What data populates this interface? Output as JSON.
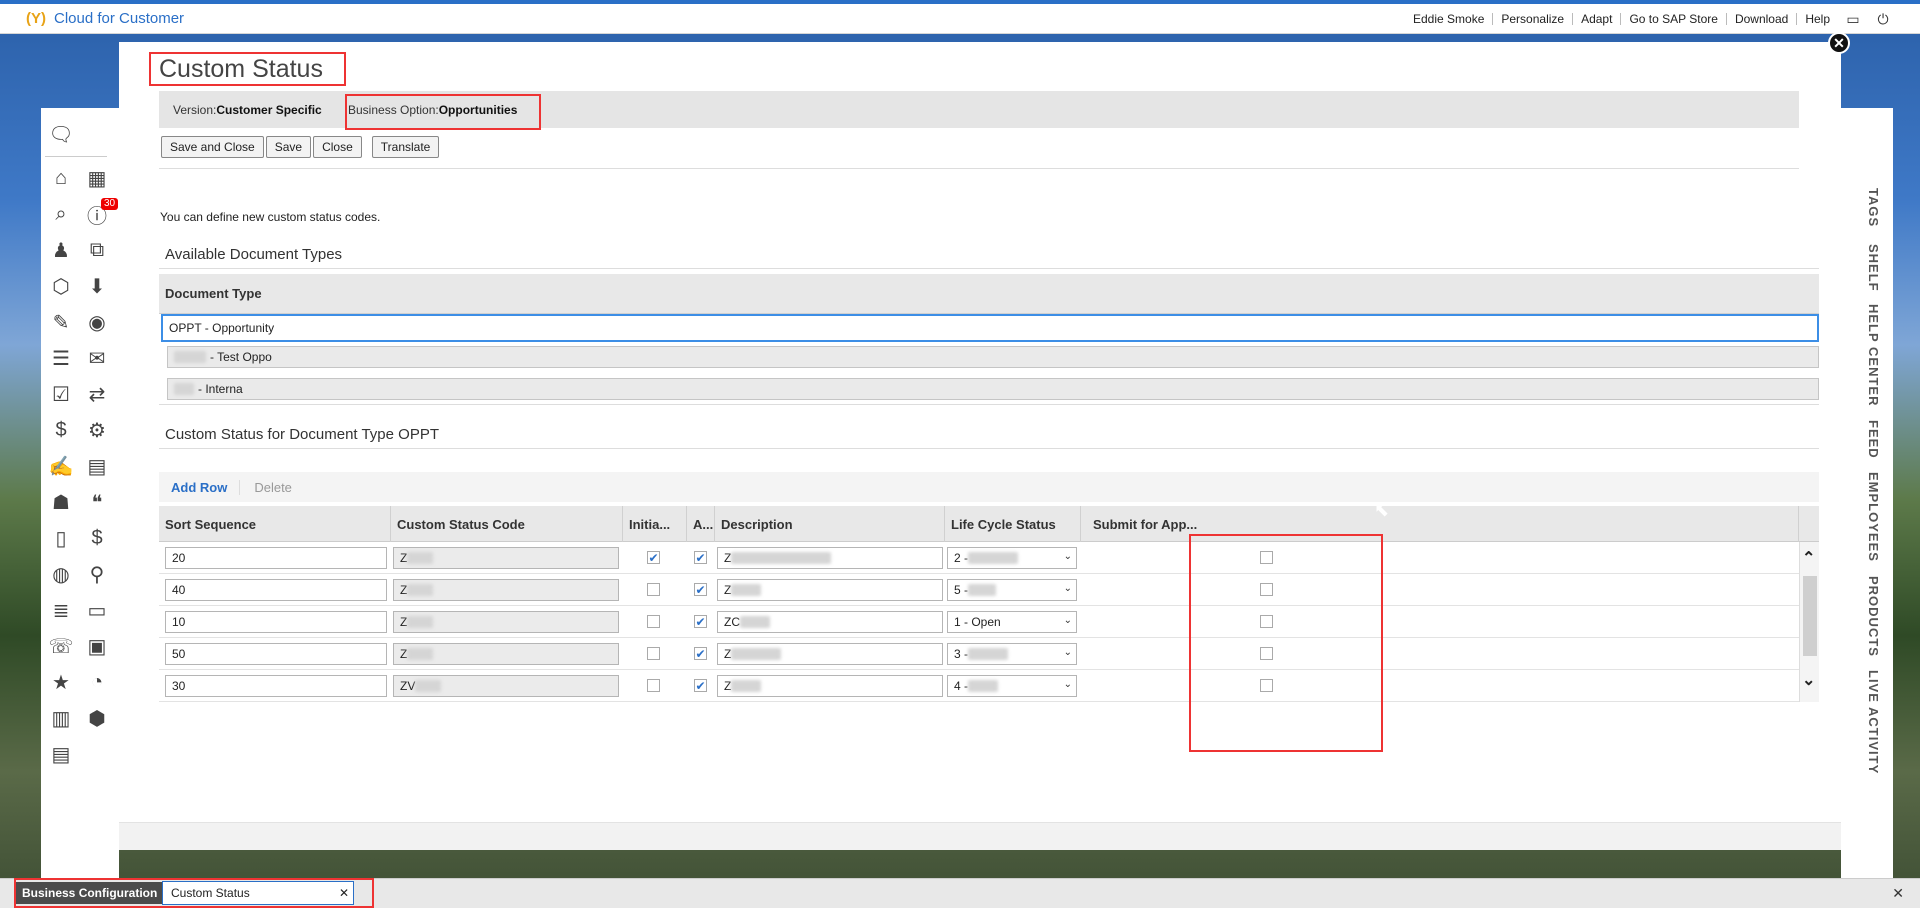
{
  "app": {
    "title": "Cloud for Customer",
    "logo_mark": "(Y)"
  },
  "topnav": {
    "items": [
      "Eddie Smoke",
      "Personalize",
      "Adapt",
      "Go to SAP Store",
      "Download",
      "Help"
    ],
    "icons": [
      "window-icon",
      "power-icon"
    ]
  },
  "left_nav": {
    "icons": [
      "chat-icon",
      "home-icon",
      "calendar-icon",
      "search-icon",
      "alert-icon",
      "team-icon",
      "org-chart-icon",
      "cube-icon",
      "download-icon",
      "analysis-icon",
      "person-icon",
      "contacts-icon",
      "mail-icon",
      "checklist-icon",
      "money-transfer-icon",
      "dollar-icon",
      "org-admin-icon",
      "edit-doc-icon",
      "calendar-grid-icon",
      "person-doc-icon",
      "quote-icon",
      "doc-icon",
      "price-icon",
      "globe-icon",
      "map-icon",
      "list-icon",
      "calendar-small-icon",
      "phone-icon",
      "clipboard-icon",
      "star-calendar-icon",
      "time-icon",
      "task-doc-icon",
      "box-icon",
      "report-icon"
    ],
    "badge": "30"
  },
  "right_tabs": [
    "TAGS",
    "SHELF",
    "HELP CENTER",
    "FEED",
    "EMPLOYEES",
    "PRODUCTS",
    "LIVE ACTIVITY"
  ],
  "dialog": {
    "title": "Custom Status",
    "version_label": "Version:",
    "version_value": "Customer Specific",
    "busopt_label": "Business Option:",
    "busopt_value": "Opportunities",
    "buttons": [
      "Save and Close",
      "Save",
      "Close",
      "Translate"
    ],
    "define_text": "You can define new custom status codes.",
    "available_title": "Available Document Types",
    "doctype_header": "Document Type",
    "doctypes": [
      {
        "label": "OPPT - Opportunity"
      },
      {
        "label": "- Test Oppo"
      },
      {
        "label": "- Interna"
      }
    ],
    "custom_title": "Custom Status for Document Type OPPT",
    "toolbar": {
      "add": "Add Row",
      "delete": "Delete"
    },
    "columns": [
      "Sort Sequence",
      "Custom Status Code",
      "Initia...",
      "A...",
      "Description",
      "Life Cycle Status",
      "Submit for App..."
    ],
    "rows": [
      {
        "sort": "20",
        "code": "Z",
        "initial": true,
        "active": true,
        "desc": "Z",
        "lifecycle": "2 -",
        "submit": false
      },
      {
        "sort": "40",
        "code": "Z",
        "initial": false,
        "active": true,
        "desc": "Z",
        "lifecycle": "5 -",
        "submit": false
      },
      {
        "sort": "10",
        "code": "Z",
        "initial": false,
        "active": true,
        "desc": "ZC",
        "lifecycle": "1 - Open",
        "submit": false
      },
      {
        "sort": "50",
        "code": "Z",
        "initial": false,
        "active": true,
        "desc": "Z",
        "lifecycle": "3 -",
        "submit": false
      },
      {
        "sort": "30",
        "code": "ZV",
        "initial": false,
        "active": true,
        "desc": "Z",
        "lifecycle": "4 -",
        "submit": false
      }
    ]
  },
  "bottombar": {
    "breadcrumb": "Business Configuration",
    "tab": "Custom Status"
  },
  "colors": {
    "accent": "#2a6fc7",
    "highlight": "#e33333",
    "badge": "#ee0000"
  }
}
